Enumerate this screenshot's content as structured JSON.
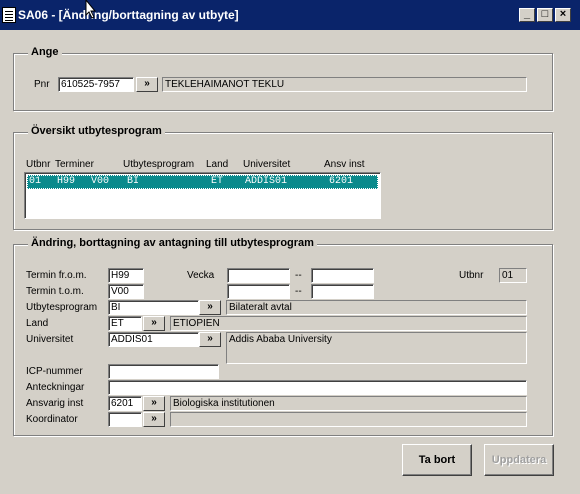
{
  "window": {
    "title": "SA06 - [Ändring/borttagning av utbyte]"
  },
  "ange": {
    "legend": "Ange",
    "pnr_label": "Pnr",
    "pnr_value": "610525-7957",
    "name_value": "TEKLEHAIMANOT TEKLU"
  },
  "lookup_symbol": "»",
  "oversikt": {
    "legend": "Översikt utbytesprogram",
    "headers": {
      "utbnr": "Utbnr",
      "terminer": "Terminer",
      "utbytesprogram": "Utbytesprogram",
      "land": "Land",
      "universitet": "Universitet",
      "ansv_inst": "Ansv inst"
    },
    "rows": [
      {
        "utbnr": "01",
        "termin_from": "H99",
        "termin_tom": "V00",
        "program": "BI",
        "land": "ET",
        "universitet": "ADDIS01",
        "ansv_inst": "6201"
      }
    ]
  },
  "andring": {
    "legend": "Ändring, borttagning av antagning till utbytesprogram",
    "termin_from_label": "Termin fr.o.m.",
    "termin_from_value": "H99",
    "termin_tom_label": "Termin t.o.m.",
    "termin_tom_value": "V00",
    "vecka_label": "Vecka",
    "dash": "--",
    "utbnr_label": "Utbnr",
    "utbnr_value": "01",
    "utbytesprogram_label": "Utbytesprogram",
    "utbytesprogram_value": "BI",
    "utbytesprogram_desc": "Bilateralt avtal",
    "land_label": "Land",
    "land_value": "ET",
    "land_desc": "ETIOPIEN",
    "universitet_label": "Universitet",
    "universitet_value": "ADDIS01",
    "universitet_desc": "Addis Ababa University",
    "icp_label": "ICP-nummer",
    "icp_value": "",
    "anteckningar_label": "Anteckningar",
    "anteckningar_value": "",
    "ansvarig_label": "Ansvarig inst",
    "ansvarig_value": "6201",
    "ansvarig_desc": "Biologiska institutionen",
    "koordinator_label": "Koordinator",
    "koordinator_value": "",
    "koordinator_desc": ""
  },
  "buttons": {
    "ta_bort": "Ta bort",
    "uppdatera": "Uppdatera"
  },
  "colors": {
    "titlebar": "#0a246a",
    "selection": "#0a8a8c",
    "face": "#d4d0c8"
  }
}
